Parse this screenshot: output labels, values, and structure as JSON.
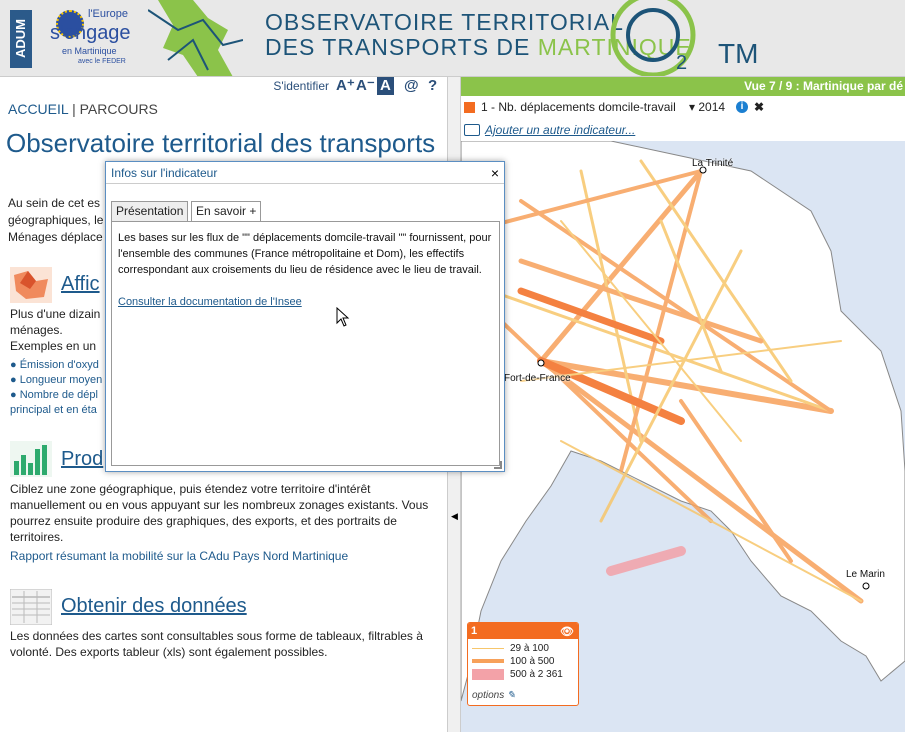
{
  "header": {
    "adum": "ADUM",
    "europe_line1": "l'Europe",
    "europe_line2": "s'engage",
    "europe_line3": "en Martinique",
    "europe_line4": "avec le FEDER",
    "title_line1": "OBSERVATOIRE TERRITORIAL",
    "title_line2_a": "DES TRANSPORTS DE ",
    "title_line2_b": "MARTINIQUE",
    "logo_two": "2",
    "logo_tm": "TM"
  },
  "toolbar": {
    "identify": "S'identifier",
    "font_bigger": "A⁺",
    "font_smaller": "A⁻",
    "contrast": "A",
    "at": "@",
    "help": "?"
  },
  "nav": {
    "home": "ACCUEIL",
    "sep": "|",
    "routes": "PARCOURS"
  },
  "left": {
    "title": "Observatoire territorial des transports",
    "intro": "Au sein de cet es géographiques, le Ménages déplace",
    "sec1": {
      "title": "Affic",
      "text1": "Plus d'une dizain ménages.",
      "text2": "Exemples en un",
      "bullets": [
        "● Émission d'oxyd",
        "● Longueur moyen",
        "● Nombre de dépl"
      ],
      "bullet_tail": "principal et en éta"
    },
    "sec2": {
      "title": "Prod",
      "text": "Ciblez une zone géographique, puis étendez votre territoire d'intérêt manuellement ou en vous appuyant sur les nombreux zonages existants. Vous pourrez ensuite produire des graphiques, des exports, et des portraits de territoires.",
      "link": "Rapport résumant la mobilité sur la CAdu Pays Nord Martinique"
    },
    "sec3": {
      "title": "Obtenir des données",
      "text": "Les données des cartes sont consultables sous forme de tableaux, filtrables à volonté. Des exports tableur (xls) sont également possibles."
    }
  },
  "map_panel": {
    "view": "Vue 7 / 9 : Martinique par dé",
    "indicator": "1 - Nb. déplacements domcile-travail",
    "year": "▾ 2014",
    "info": "i",
    "close": "✖",
    "add": "Ajouter un autre indicateur...",
    "cities": {
      "trinite": "La Trinité",
      "fdf": "Fort-de-France",
      "marin": "Le Marin"
    },
    "colors": {
      "accent": "#f36c21",
      "bar": "#8bc34a",
      "sea": "#dbe5f3"
    },
    "legend": {
      "number": "1",
      "rows": [
        {
          "label": "29 à 100",
          "color": "#f7c66b"
        },
        {
          "label": "100 à 500",
          "color": "#f7a15a"
        },
        {
          "label": "500 à 2 361",
          "color": "#f3a2a8"
        }
      ],
      "options": "options"
    }
  },
  "dialog": {
    "title": "Infos sur l'indicateur",
    "close": "×",
    "tab1": "Présentation",
    "tab2": "En savoir +",
    "body": "Les bases sur les flux de \"\" déplacements domcile-travail \"\" fournissent, pour l'ensemble des communes (France métropolitaine et Dom), les effectifs correspondant aux croisements du lieu de résidence avec le lieu de travail.",
    "link": "Consulter la documentation de l'Insee"
  }
}
